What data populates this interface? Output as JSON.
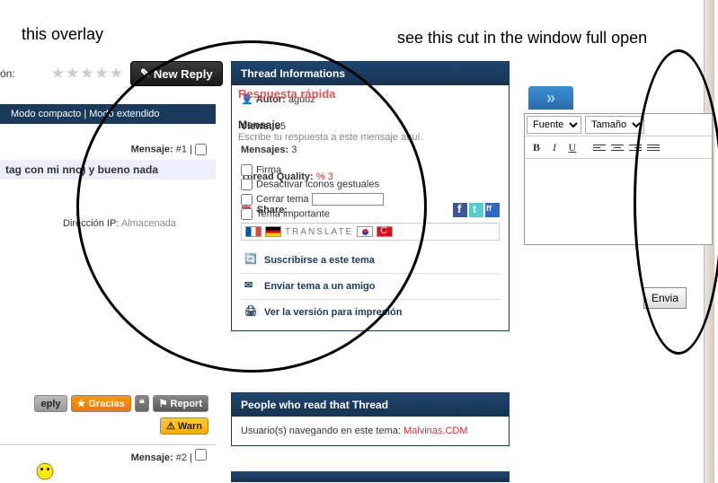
{
  "annotations": {
    "overlay": "this overlay",
    "cut": "see this cut in the window full open"
  },
  "top": {
    "on_label": "ón:",
    "new_reply": "New Reply"
  },
  "mode": {
    "compact": "Modo compacto",
    "extended": "Modo extendido"
  },
  "msg1": {
    "label": "Mensaje:",
    "num": "#1",
    "pipe": "|"
  },
  "msg1_title": " tag con mi nno) y bueno nada",
  "ip": {
    "label": "Dirección IP:",
    "value": "Almacenada"
  },
  "actions": {
    "reply": "eply",
    "gracias": "Gracias",
    "report": "Report",
    "warn": "Warn"
  },
  "msg2": {
    "label": "Mensaje:",
    "num": "#2",
    "pipe": "|"
  },
  "thread_info": {
    "title": "Thread Informations",
    "autor_label": "Autor:",
    "autor": "aguuz",
    "views_label": "Views:",
    "views": "35",
    "mensajes_label": "Mensajes:",
    "mensajes": "3",
    "quality_label": "Thread Quality:",
    "quality": "% 3",
    "share_label": "Share:",
    "translate": "TRANSLATE",
    "subscribe": "Suscribirse a este tema",
    "send_friend": "Enviar tema a un amigo",
    "print": "Ver la versión para impresión"
  },
  "quick": {
    "title": "Respuesta rápida",
    "mensaje_label": "Mensaje",
    "placeholder": "Escribe tu respuesta a este mensaje aquí.",
    "firma": "Firma",
    "desactivar": "Desactivar iconos gestuales",
    "cerrar": "Cerrar tema",
    "importante": "Tema importante"
  },
  "editor": {
    "fuente": "Fuente",
    "tamano": "Tamaño",
    "send": "Envia"
  },
  "people": {
    "title": "People who read that Thread",
    "navegando": "Usuario(s) navegando en este tema:",
    "user": "Malvinas.CDM"
  }
}
